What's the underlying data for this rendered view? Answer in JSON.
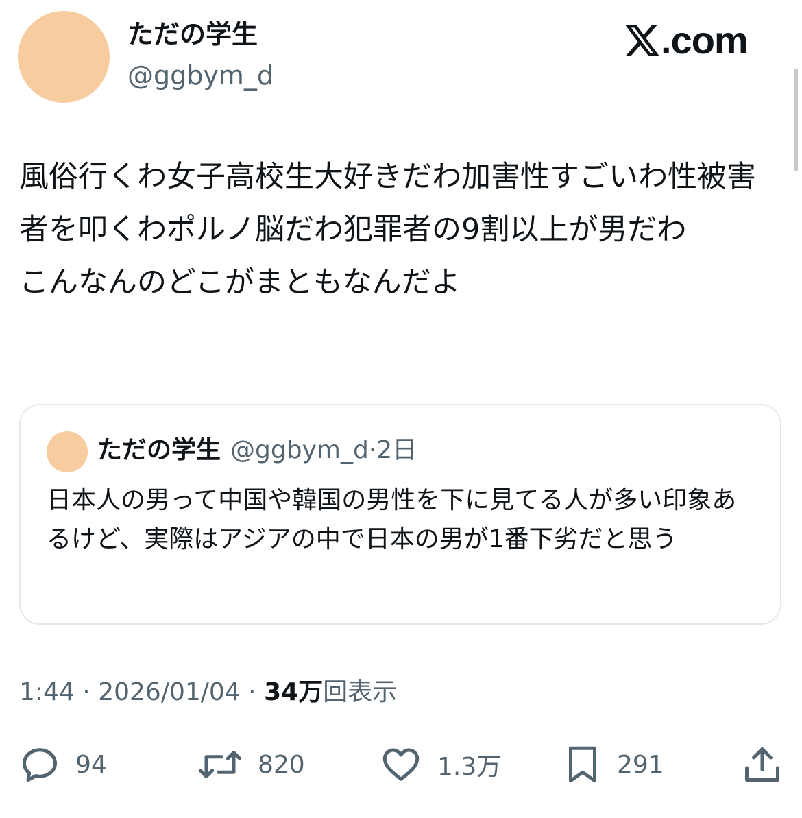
{
  "author": {
    "display_name": "ただの学生",
    "handle": "@ggbym_d",
    "avatar_color": "#f7cc9f"
  },
  "brand": {
    "logo_icon": "x-logo-icon",
    "domain_suffix": ".com"
  },
  "tweet": {
    "text": "風俗行くわ女子高校生大好きだわ加害性すごいわ性被害者を叩くわポルノ脳だわ犯罪者の9割以上が男だわ\nこんなんのどこがまともなんだよ"
  },
  "quoted_tweet": {
    "display_name": "ただの学生",
    "handle": "@ggbym_d",
    "separator": "·",
    "date": "2日",
    "text": "日本人の男って中国や韓国の男性を下に見てる人が多い印象あるけど、実際はアジアの中で日本の男が1番下劣だと思う"
  },
  "meta": {
    "time": "1:44",
    "separator": "·",
    "date": "2026/01/04",
    "views_count": "34万",
    "views_label": "回表示"
  },
  "actions": {
    "reply": {
      "icon": "reply-icon",
      "count": "94"
    },
    "repost": {
      "icon": "repost-icon",
      "count": "820"
    },
    "like": {
      "icon": "heart-icon",
      "count": "1.3万"
    },
    "bookmark": {
      "icon": "bookmark-icon",
      "count": "291"
    },
    "share": {
      "icon": "share-icon"
    }
  },
  "colors": {
    "text_primary": "#0f1419",
    "text_secondary": "#536471",
    "border": "#e6e9ec"
  }
}
